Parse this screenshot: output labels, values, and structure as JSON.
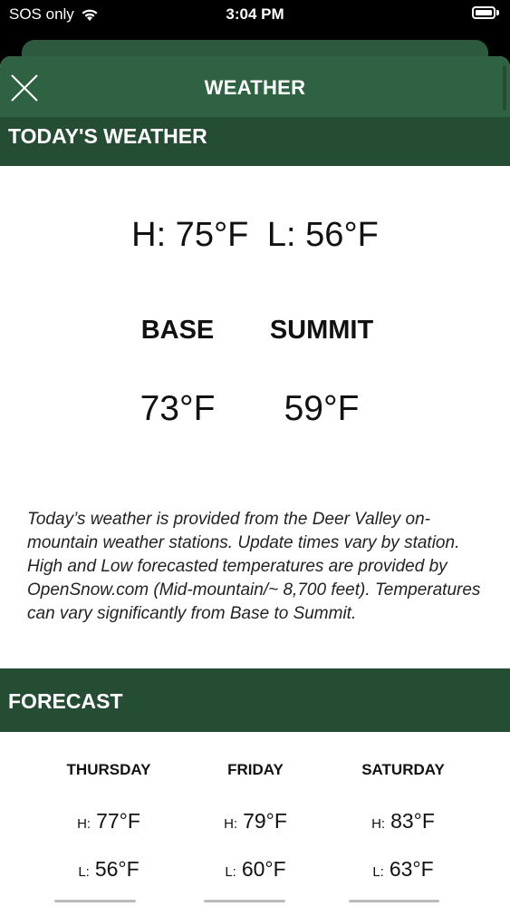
{
  "status_bar": {
    "carrier": "SOS only",
    "time": "3:04 PM",
    "battery_level": 1.0
  },
  "header": {
    "title": "WEATHER",
    "close_icon": "close-icon"
  },
  "today": {
    "section_title": "TODAY'S WEATHER",
    "high": "H: 75°F",
    "low": "L: 56°F",
    "base_label": "BASE",
    "summit_label": "SUMMIT",
    "base_temp": "73°F",
    "summit_temp": "59°F",
    "disclaimer": "Today’s weather is provided from the Deer Valley on-mountain weather stations. Update times vary by station. High and Low forecasted temperatures are provided by OpenSnow.com (Mid-mountain/~ 8,700 feet). Temperatures can vary significantly from Base to Summit."
  },
  "forecast": {
    "section_title": "FORECAST",
    "high_prefix": "H:",
    "low_prefix": "L:",
    "days": [
      {
        "name": "THURSDAY",
        "high": "77°F",
        "low": "56°F"
      },
      {
        "name": "FRIDAY",
        "high": "79°F",
        "low": "60°F"
      },
      {
        "name": "SATURDAY",
        "high": "83°F",
        "low": "63°F"
      }
    ]
  },
  "colors": {
    "header_green": "#2f6242",
    "section_green": "#254d34"
  }
}
